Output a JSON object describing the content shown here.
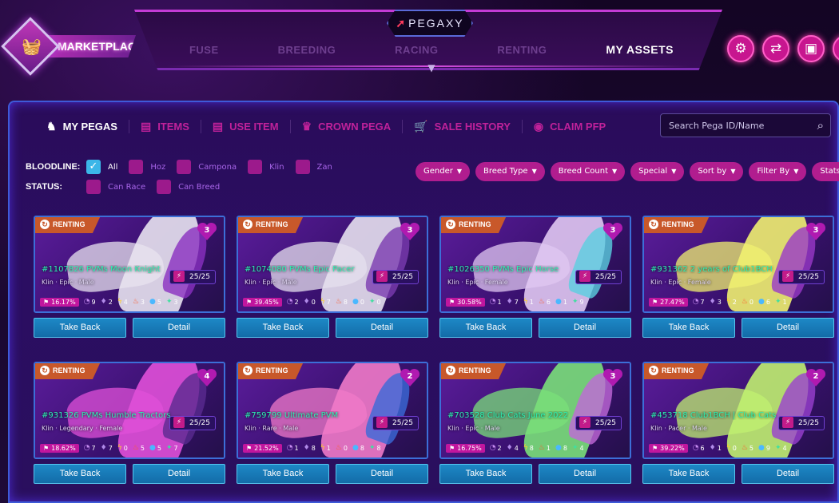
{
  "app": {
    "market_label": "MARKETPLACE",
    "brand": "PEGAXY",
    "nav_tabs": [
      "FUSE",
      "BREEDING",
      "RACING",
      "RENTING",
      "MY ASSETS"
    ],
    "active_nav": "MY ASSETS"
  },
  "top_icons": [
    "settings-icon",
    "swap-icon",
    "wallet-icon",
    "logout-icon"
  ],
  "sub_tabs": [
    {
      "label": "MY PEGAS",
      "icon": "horse-icon"
    },
    {
      "label": "ITEMS",
      "icon": "chest-icon"
    },
    {
      "label": "USE ITEM",
      "icon": "chest-icon"
    },
    {
      "label": "CROWN PEGA",
      "icon": "crown-icon"
    },
    {
      "label": "SALE HISTORY",
      "icon": "cart-icon"
    },
    {
      "label": "CLAIM PFP",
      "icon": "pfp-icon"
    }
  ],
  "search": {
    "placeholder": "Search Pega ID/Name"
  },
  "filters": {
    "bloodline_label": "BLOODLINE:",
    "bloodline": [
      {
        "label": "All",
        "checked": true
      },
      {
        "label": "Hoz",
        "checked": false
      },
      {
        "label": "Campona",
        "checked": false
      },
      {
        "label": "Klin",
        "checked": false
      },
      {
        "label": "Zan",
        "checked": false
      }
    ],
    "status_label": "STATUS:",
    "status": [
      {
        "label": "Can Race",
        "checked": false
      },
      {
        "label": "Can Breed",
        "checked": false
      }
    ],
    "dropdowns": [
      "Gender",
      "Breed Type",
      "Breed Count",
      "Special",
      "Sort by",
      "Filter By",
      "Stats"
    ]
  },
  "buttons": {
    "take_back": "Take Back",
    "detail": "Detail"
  },
  "renting_label": "RENTING",
  "cards": [
    {
      "name": "#1107826 PVMs Moon Knight",
      "meta": "Klin  ·  Epic  ·  Male",
      "hearts": "3",
      "energy": "25/25",
      "pct": "16.17%",
      "stats": [
        "9",
        "2",
        "4",
        "3",
        "5",
        "3"
      ],
      "colors": [
        "#e8e3ef",
        "#8a2fc0"
      ]
    },
    {
      "name": "#1074080 PVMs Epic Pacer",
      "meta": "Klin  ·  Epic  ·  Male",
      "hearts": "3",
      "energy": "25/25",
      "pct": "39.45%",
      "stats": [
        "2",
        "0",
        "7",
        "8",
        "0",
        "0"
      ],
      "colors": [
        "#e6e0ee",
        "#7a3bb0"
      ]
    },
    {
      "name": "#1026350 PVMs Epic Horse",
      "meta": "Klin  ·  Epic  ·  Female",
      "hearts": "3",
      "energy": "25/25",
      "pct": "30.58%",
      "stats": [
        "1",
        "7",
        "1",
        "6",
        "1",
        "9"
      ],
      "colors": [
        "#e0c8f2",
        "#5acfe0"
      ]
    },
    {
      "name": "#931362 2 years of Club1BCH",
      "meta": "Klin  ·  Epic  ·  Female",
      "hearts": "3",
      "energy": "25/25",
      "pct": "27.47%",
      "stats": [
        "7",
        "3",
        "2",
        "0",
        "6",
        "1"
      ],
      "colors": [
        "#f0f070",
        "#9a38c8"
      ]
    },
    {
      "name": "#931326 PVMs Humble Tractors N...",
      "meta": "Klin  ·  Legendary  ·  Female",
      "hearts": "4",
      "energy": "25/25",
      "pct": "18.62%",
      "stats": [
        "7",
        "7",
        "0",
        "5",
        "5",
        "7"
      ],
      "colors": [
        "#e050d8",
        "#5a2a90"
      ]
    },
    {
      "name": "#759799 Ultimate PVM",
      "meta": "Klin  ·  Rare  ·  Male",
      "hearts": "2",
      "energy": "25/25",
      "pct": "21.52%",
      "stats": [
        "1",
        "8",
        "1",
        "0",
        "8",
        "8"
      ],
      "colors": [
        "#f07ac8",
        "#3a6ad8"
      ]
    },
    {
      "name": "#703528 Club Cats June 2022",
      "meta": "Klin  ·  Epic  ·  Male",
      "hearts": "3",
      "energy": "25/25",
      "pct": "16.75%",
      "stats": [
        "2",
        "4",
        "8",
        "1",
        "8",
        "4"
      ],
      "colors": [
        "#7ae07a",
        "#c068d8"
      ]
    },
    {
      "name": "#453718 Club1BCH | Club Cats",
      "meta": "Klin  ·  Pacer  ·  Male",
      "hearts": "2",
      "energy": "25/25",
      "pct": "39.22%",
      "stats": [
        "6",
        "1",
        "0",
        "5",
        "9",
        "4"
      ],
      "colors": [
        "#c0f070",
        "#9a40d0"
      ]
    }
  ]
}
